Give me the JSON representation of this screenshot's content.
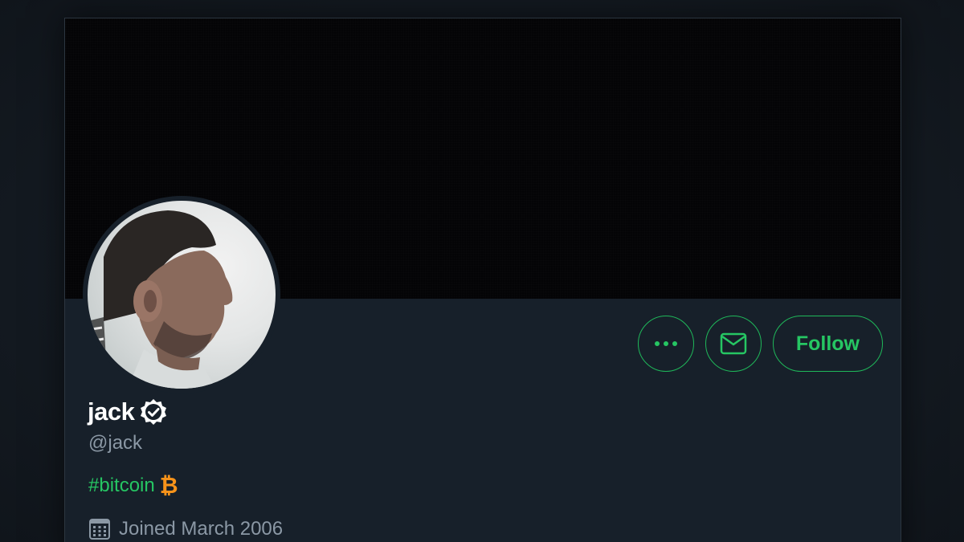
{
  "profile": {
    "display_name": "jack",
    "handle": "@jack",
    "bio_hashtag": "#bitcoin",
    "bio_emoji_icon": "bitcoin-icon",
    "bio_emoji_glyph": "₿",
    "joined": "Joined March 2006",
    "verified": true
  },
  "actions": {
    "more_icon": "more-dots-icon",
    "message_icon": "envelope-icon",
    "follow_label": "Follow"
  },
  "colors": {
    "accent": "#26c663",
    "background": "#17202a",
    "banner": "#040406",
    "muted_text": "#8b98a5",
    "bitcoin": "#f7931a"
  }
}
